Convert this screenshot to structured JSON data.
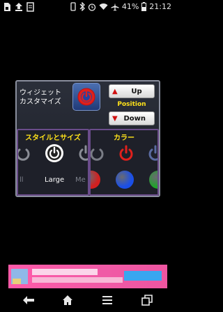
{
  "status_bar": {
    "battery": "41%",
    "time": "21:12",
    "icons": [
      "sim-card-icon",
      "upload-icon",
      "document-icon",
      "vibrate-icon",
      "bluetooth-icon",
      "alarm-icon",
      "wifi-icon",
      "airplane-icon",
      "battery-icon"
    ]
  },
  "widget": {
    "label_line1": "ウィジェット",
    "label_line2": "カスタマイズ",
    "up_label": "Up",
    "down_label": "Down",
    "position_label": "Position"
  },
  "style_section": {
    "title": "スタイルとサイズ",
    "size_left": "ll",
    "size_selected": "Large",
    "size_right": "Me"
  },
  "color_section": {
    "title": "カラー",
    "swatches": [
      "#d22020",
      "#1a4fe8",
      "#1fa42a"
    ]
  },
  "colors": {
    "accent_yellow": "#ffe21a",
    "power_red": "#e0201c",
    "ad_pink": "#f05aa6"
  },
  "nav": {
    "icons": [
      "back-icon",
      "home-icon",
      "menu-icon",
      "recents-icon"
    ]
  }
}
